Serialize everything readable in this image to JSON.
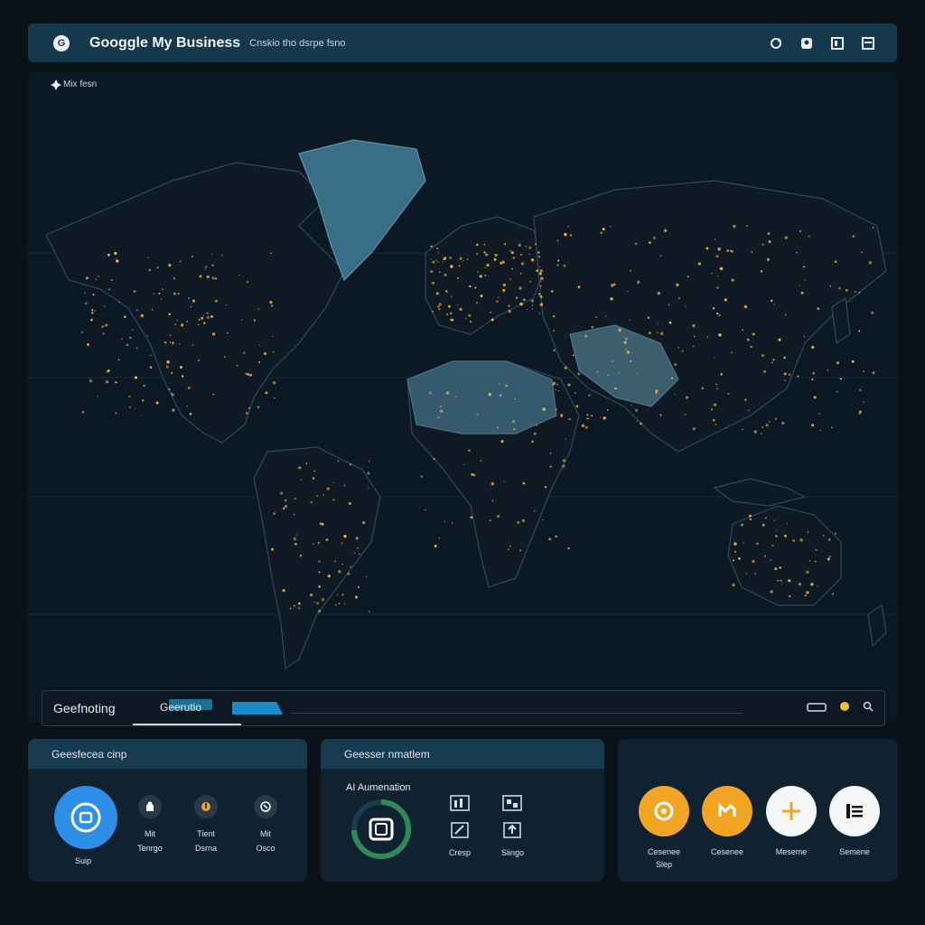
{
  "header": {
    "logo_glyph": "G",
    "title": "Googgle My Business",
    "subtitle": "Cnskio tho dsrpe fsno",
    "icons": [
      "refresh-icon",
      "account-icon",
      "layout-icon",
      "window-icon"
    ]
  },
  "map": {
    "tool_label": "Mix fesn"
  },
  "geo_bar": {
    "label": "Geefnoting",
    "tab_label": "Geerutio"
  },
  "panels": {
    "left": {
      "title": "Geesfecea cinp",
      "primary_label": "Suip",
      "items": [
        {
          "line1": "Mit",
          "line2": "Tenrgo"
        },
        {
          "line1": "Tient",
          "line2": "Dsrna"
        },
        {
          "line1": "Mit",
          "line2": "Osco"
        }
      ]
    },
    "middle": {
      "title": "Geesser nmatlem",
      "ai_title": "AI Aumenation",
      "icons": [
        {
          "label": ""
        },
        {
          "label": ""
        },
        {
          "label": "Cresp"
        },
        {
          "label": "Siingo"
        }
      ]
    },
    "right": {
      "actions": [
        {
          "line1": "Cesenee",
          "line2": "Slep",
          "color": "#f2a524"
        },
        {
          "line1": "Cesenee",
          "line2": "",
          "color": "#f2a524"
        },
        {
          "line1": "Meseme",
          "line2": "",
          "color": "#f4f6f7"
        },
        {
          "line1": "Semene",
          "line2": "",
          "color": "#f4f6f7"
        }
      ]
    }
  },
  "colors": {
    "accent_blue": "#2e8ee8",
    "accent_orange": "#f2a524",
    "land": "#0f1a24",
    "ice": "#3a6e86",
    "city_lights": "#f0b34a"
  }
}
